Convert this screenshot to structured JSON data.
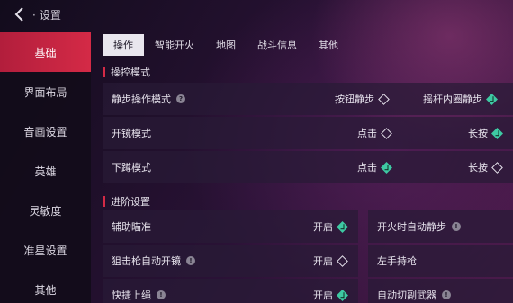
{
  "topbar": {
    "title": "设置"
  },
  "sidebar": {
    "items": [
      {
        "label": "基础"
      },
      {
        "label": "界面布局"
      },
      {
        "label": "音画设置"
      },
      {
        "label": "英雄"
      },
      {
        "label": "灵敏度"
      },
      {
        "label": "准星设置"
      },
      {
        "label": "其他"
      }
    ]
  },
  "tabs": [
    {
      "label": "操作"
    },
    {
      "label": "智能开火"
    },
    {
      "label": "地图"
    },
    {
      "label": "战斗信息"
    },
    {
      "label": "其他"
    }
  ],
  "sections": {
    "control_mode": "操控模式",
    "advanced": "进阶设置"
  },
  "control": {
    "quiet_step": {
      "label": "静步操作模式",
      "opt1": "按钮静步",
      "opt2": "摇杆内圈静步"
    },
    "scope": {
      "label": "开镜模式",
      "opt1": "点击",
      "opt2": "长按"
    },
    "crouch": {
      "label": "下蹲模式",
      "opt1": "点击",
      "opt2": "长按"
    }
  },
  "advanced": {
    "aim_assist": {
      "label": "辅助瞄准",
      "value": "开启"
    },
    "auto_quiet": {
      "label": "开火时自动静步"
    },
    "sniper_scope": {
      "label": "狙击枪自动开镜",
      "value": "开启"
    },
    "left_hand": {
      "label": "左手持枪"
    },
    "quick_rope": {
      "label": "快捷上绳",
      "value": "开启"
    },
    "auto_switch": {
      "label": "自动切副武器"
    }
  },
  "colors": {
    "accent": "#d42a46",
    "check": "#3ec9a3"
  },
  "icons": {
    "back": "back-arrow-icon",
    "info": "info-icon",
    "diamond": "diamond-check-icon"
  }
}
